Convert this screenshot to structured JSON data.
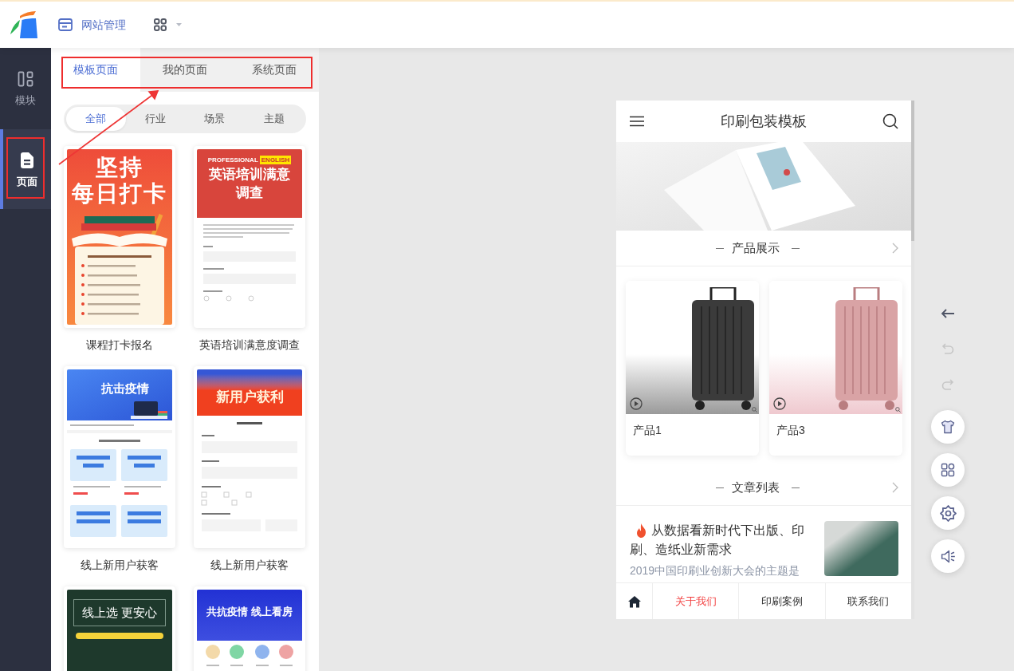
{
  "topbar": {
    "nav_label": "网站管理"
  },
  "rail": {
    "items": [
      {
        "kind": "blocks",
        "label": "模块",
        "selected": false,
        "highlighted": false
      },
      {
        "kind": "page",
        "label": "页面",
        "selected": true,
        "highlighted": true
      }
    ]
  },
  "panel": {
    "tabs": [
      {
        "label": "模板页面",
        "selected": true
      },
      {
        "label": "我的页面",
        "selected": false
      },
      {
        "label": "系统页面",
        "selected": false
      }
    ],
    "tabs_highlighted": true,
    "filters": [
      {
        "label": "全部",
        "selected": true
      },
      {
        "label": "行业",
        "selected": false
      },
      {
        "label": "场景",
        "selected": false
      },
      {
        "label": "主题",
        "selected": false
      }
    ],
    "templates": [
      {
        "kind": "checkin",
        "headline": [
          "坚持",
          "每日打卡"
        ],
        "name": "课程打卡报名"
      },
      {
        "kind": "survey",
        "kicker": "PROFESSIONAL",
        "badge": "ENGLISH",
        "headline": [
          "英语培训满意",
          "调查"
        ],
        "name": "英语培训满意度调查"
      },
      {
        "kind": "course",
        "headline": [
          "抗击疫情"
        ],
        "name": "线上新用户获客"
      },
      {
        "kind": "signup",
        "headline": [
          "新用户获利"
        ],
        "name": "线上新用户获客"
      },
      {
        "kind": "chalkboard",
        "headline": [
          "线上选 更安心"
        ]
      },
      {
        "kind": "housing",
        "headline": [
          "共抗疫情 线上看房"
        ]
      }
    ]
  },
  "callout_arrow": true,
  "preview": {
    "title": "印刷包装模板",
    "sections": [
      {
        "title": "产品展示"
      },
      {
        "title": "文章列表"
      }
    ],
    "products": [
      {
        "name": "产品1",
        "kind": "black"
      },
      {
        "name": "产品3",
        "kind": "pink"
      }
    ],
    "article": {
      "title": "从数据看新时代下出版、印刷、造纸业新需求",
      "summary": "2019中国印刷业创新大会的主题是",
      "hot": true
    },
    "bottom_nav": [
      {
        "kind": "home",
        "selected": false
      },
      {
        "kind": "link",
        "label": "关于我们",
        "selected": true
      },
      {
        "kind": "link",
        "label": "印刷案例",
        "selected": false
      },
      {
        "kind": "link",
        "label": "联系我们",
        "selected": false
      }
    ]
  },
  "tools": [
    {
      "kind": "back",
      "disabled": false
    },
    {
      "kind": "undo",
      "disabled": true
    },
    {
      "kind": "redo",
      "disabled": true
    },
    {
      "kind": "theme"
    },
    {
      "kind": "components"
    },
    {
      "kind": "settings"
    },
    {
      "kind": "audio"
    }
  ]
}
